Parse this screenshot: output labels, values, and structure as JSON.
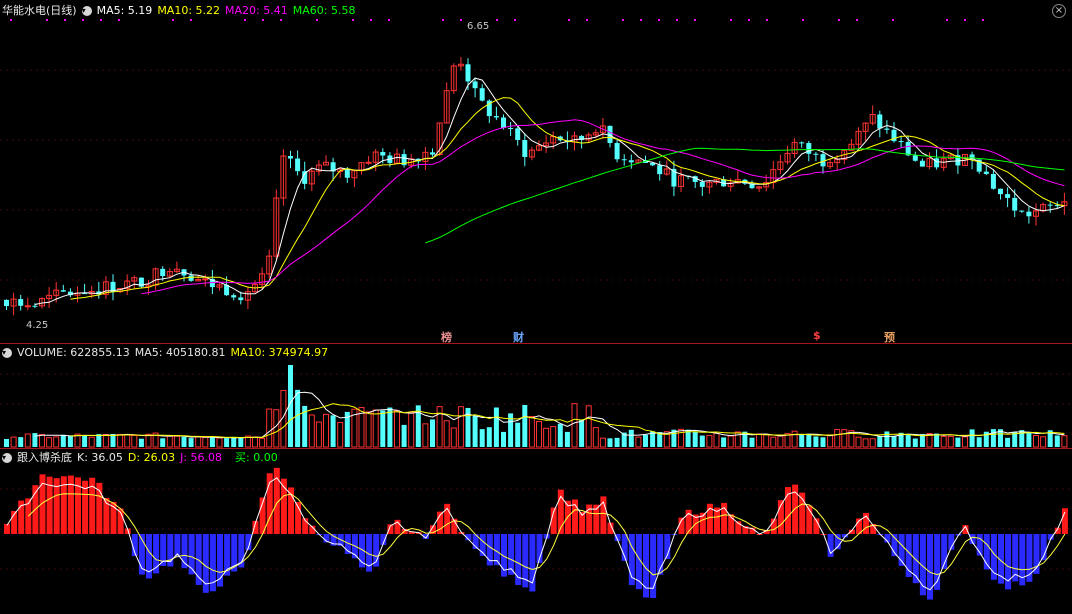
{
  "price_panel": {
    "title": "华能水电(日线)",
    "ma5_label": "MA5: 5.19",
    "ma10_label": "MA10: 5.22",
    "ma20_label": "MA20: 5.41",
    "ma60_label": "MA60: 5.58",
    "high_marker": "6.65",
    "low_marker": "4.25",
    "event_marks": [
      "榜",
      "财",
      "$",
      "预"
    ],
    "close_glyph": "×",
    "colors": {
      "ma5": "#ffffff",
      "ma10": "#ffff00",
      "ma20": "#ff00ff",
      "ma60": "#00ff00",
      "up": "#ff3232",
      "down": "#54ffff"
    }
  },
  "volume_panel": {
    "volume_label": "VOLUME: 622855.13",
    "ma5_label": "MA5: 405180.81",
    "ma10_label": "MA10: 374974.97"
  },
  "indicator_panel": {
    "title": "跟入博杀底",
    "k_label": "K: 36.05",
    "d_label": "D: 26.03",
    "j_label": "J: 56.08",
    "buy_label": "买: 0.00"
  },
  "toggle_glyph": "▾"
}
